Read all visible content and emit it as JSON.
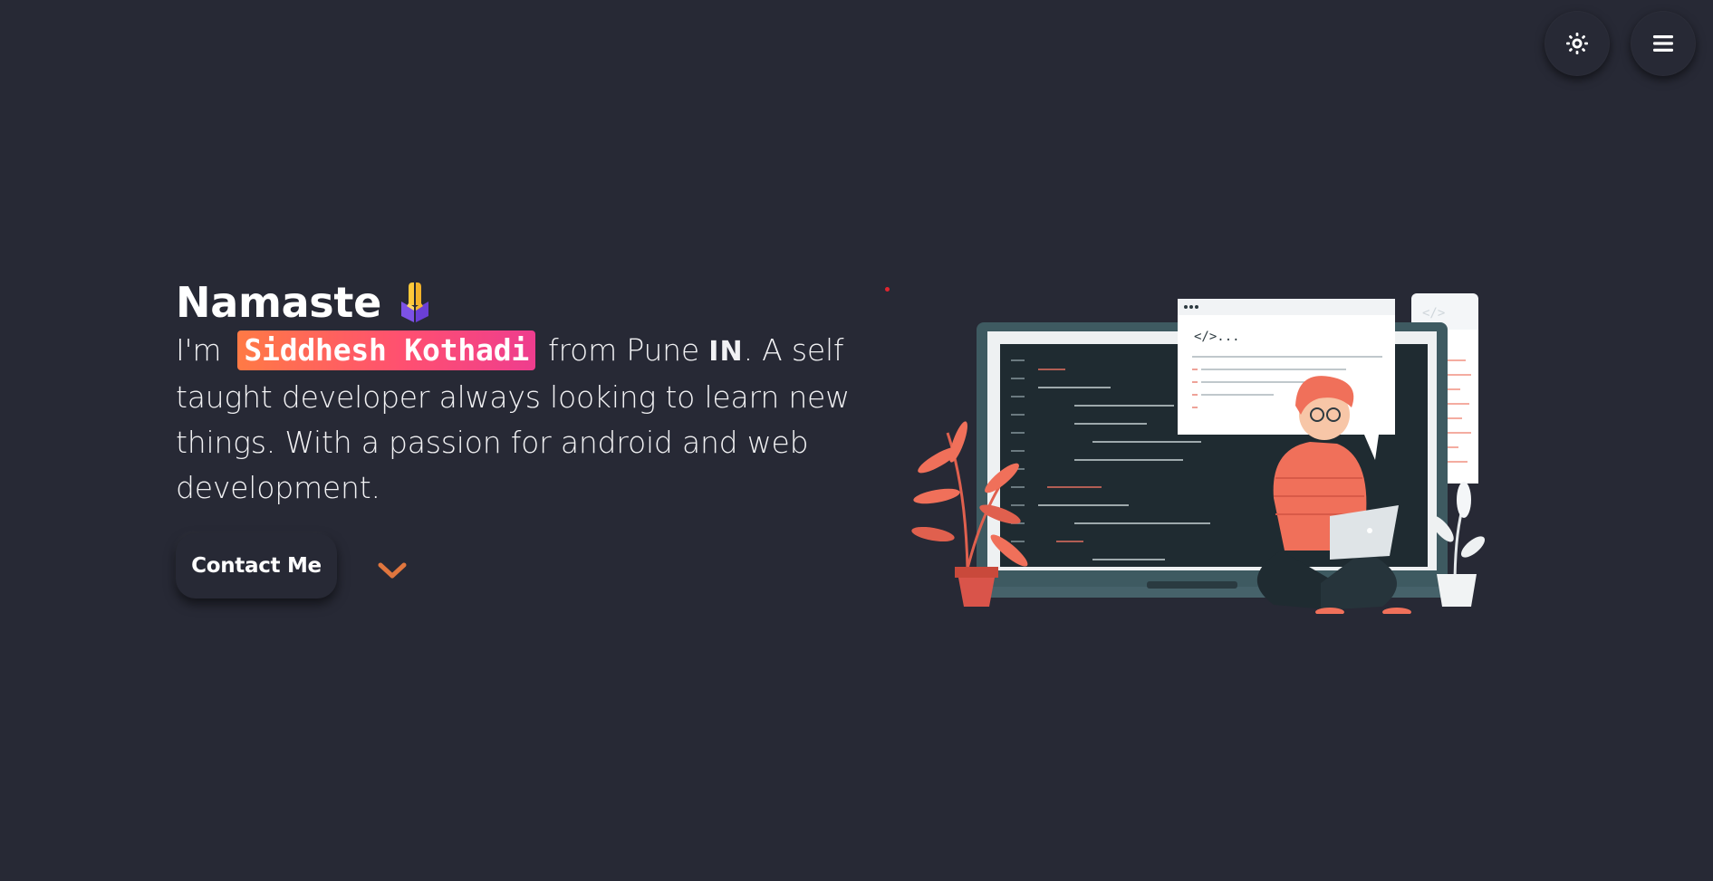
{
  "header": {
    "theme_toggle_icon": "sun-icon",
    "menu_icon": "hamburger-menu-icon"
  },
  "hero": {
    "greeting": "Namaste",
    "greeting_icon": "folded-hands-icon",
    "intro_prefix": "I'm",
    "name": "Siddhesh Kothadi",
    "from_text": "from Pune",
    "country": "IN",
    "sentence_end": ". A",
    "description": "self taught developer always looking to learn new things. With a passion for android and web development.",
    "contact_label": "Contact Me",
    "scroll_icon": "chevron-down-icon"
  },
  "illustration": {
    "code_tag": "</>...",
    "code_tag_faded": "</>"
  },
  "colors": {
    "background": "#272935",
    "accent_orange": "#ff7a45",
    "accent_pink": "#ee3d8e",
    "chevron": "#e0763e",
    "illustration_coral": "#f0705a"
  }
}
